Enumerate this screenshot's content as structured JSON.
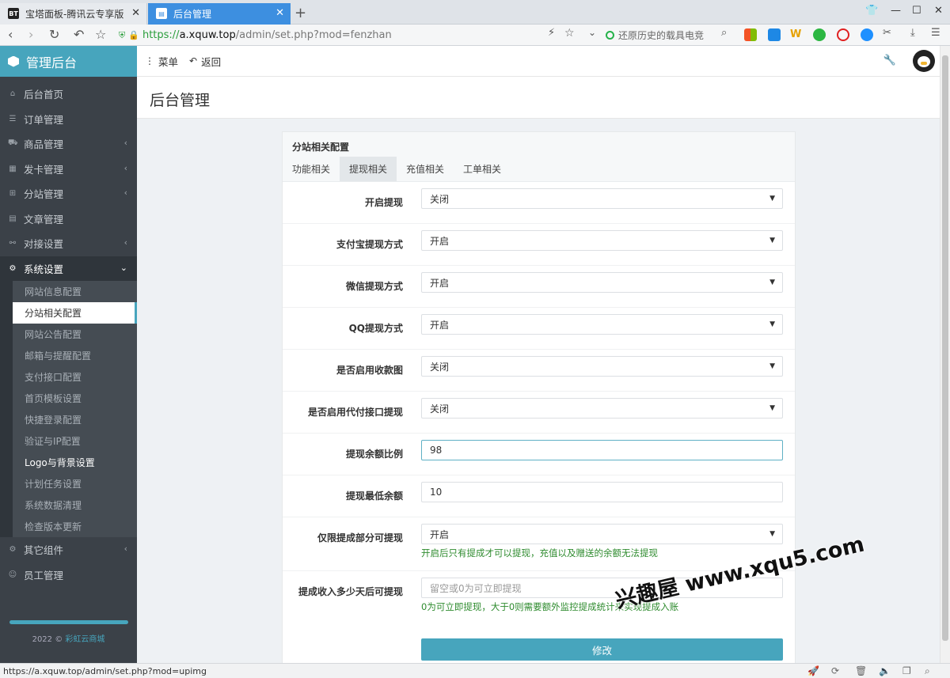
{
  "browser": {
    "tabs": [
      {
        "favicon": "BT",
        "title": "宝塔面板-腾讯云专享版"
      },
      {
        "favicon": "▤",
        "title": "后台管理"
      }
    ],
    "url": {
      "scheme": "https://",
      "host": "a.xquw.top",
      "path": "/admin/set.php?mod=fenzhan"
    },
    "search_text": "还原历史的载具电竞",
    "status_url": "https://a.xquw.top/admin/set.php?mod=upimg"
  },
  "app": {
    "brand": "管理后台",
    "topbar": {
      "menu_label": "菜单",
      "back_label": "返回"
    },
    "page_title": "后台管理",
    "footer": {
      "year_text": "2022 ©",
      "link_text": "彩虹云商城"
    }
  },
  "sidebar": {
    "items": [
      {
        "label": "后台首页",
        "icon": "home-icon",
        "chevron": false
      },
      {
        "label": "订单管理",
        "icon": "list-icon",
        "chevron": false
      },
      {
        "label": "商品管理",
        "icon": "cart-icon",
        "chevron": true
      },
      {
        "label": "发卡管理",
        "icon": "grid-icon",
        "chevron": true
      },
      {
        "label": "分站管理",
        "icon": "sitemap-icon",
        "chevron": true
      },
      {
        "label": "文章管理",
        "icon": "book-icon",
        "chevron": false
      },
      {
        "label": "对接设置",
        "icon": "plug-icon",
        "chevron": true
      }
    ],
    "open_item": {
      "label": "系统设置",
      "icon": "gear-icon"
    },
    "sub_items": [
      "网站信息配置",
      "分站相关配置",
      "网站公告配置",
      "邮箱与提醒配置",
      "支付接口配置",
      "首页模板设置",
      "快捷登录配置",
      "验证与IP配置",
      "Logo与背景设置",
      "计划任务设置",
      "系统数据清理",
      "检查版本更新"
    ],
    "active_sub": "分站相关配置",
    "bottom_items": [
      {
        "label": "其它组件",
        "icon": "cogs-icon",
        "chevron": true
      },
      {
        "label": "员工管理",
        "icon": "user-icon",
        "chevron": false
      }
    ]
  },
  "panel": {
    "title": "分站相关配置",
    "tabs": [
      "功能相关",
      "提现相关",
      "充值相关",
      "工单相关"
    ],
    "active_tab": "提现相关",
    "fields": [
      {
        "label": "开启提现",
        "type": "select",
        "value": "关闭"
      },
      {
        "label": "支付宝提现方式",
        "type": "select",
        "value": "开启"
      },
      {
        "label": "微信提现方式",
        "type": "select",
        "value": "开启"
      },
      {
        "label": "QQ提现方式",
        "type": "select",
        "value": "开启"
      },
      {
        "label": "是否启用收款图",
        "type": "select",
        "value": "关闭"
      },
      {
        "label": "是否启用代付接口提现",
        "type": "select",
        "value": "关闭"
      },
      {
        "label": "提现余额比例",
        "type": "input",
        "value": "98"
      },
      {
        "label": "提现最低余额",
        "type": "input",
        "value": "10"
      },
      {
        "label": "仅限提成部分可提现",
        "type": "select",
        "value": "开启",
        "help": "开启后只有提成才可以提现，充值以及赠送的余额无法提现"
      },
      {
        "label": "提成收入多少天后可提现",
        "type": "input",
        "value": "",
        "placeholder": "留空或0为可立即提现",
        "help": "0为可立即提现，大于0则需要额外监控提成统计来实现提成入账"
      }
    ],
    "submit_label": "修改"
  },
  "watermark": "兴趣屋 www.xqu5.com",
  "colors": {
    "accent": "#47a5bd",
    "sidebar": "#3b4148",
    "help": "#2e8b2e",
    "tab_active": "#3d8fe0"
  }
}
